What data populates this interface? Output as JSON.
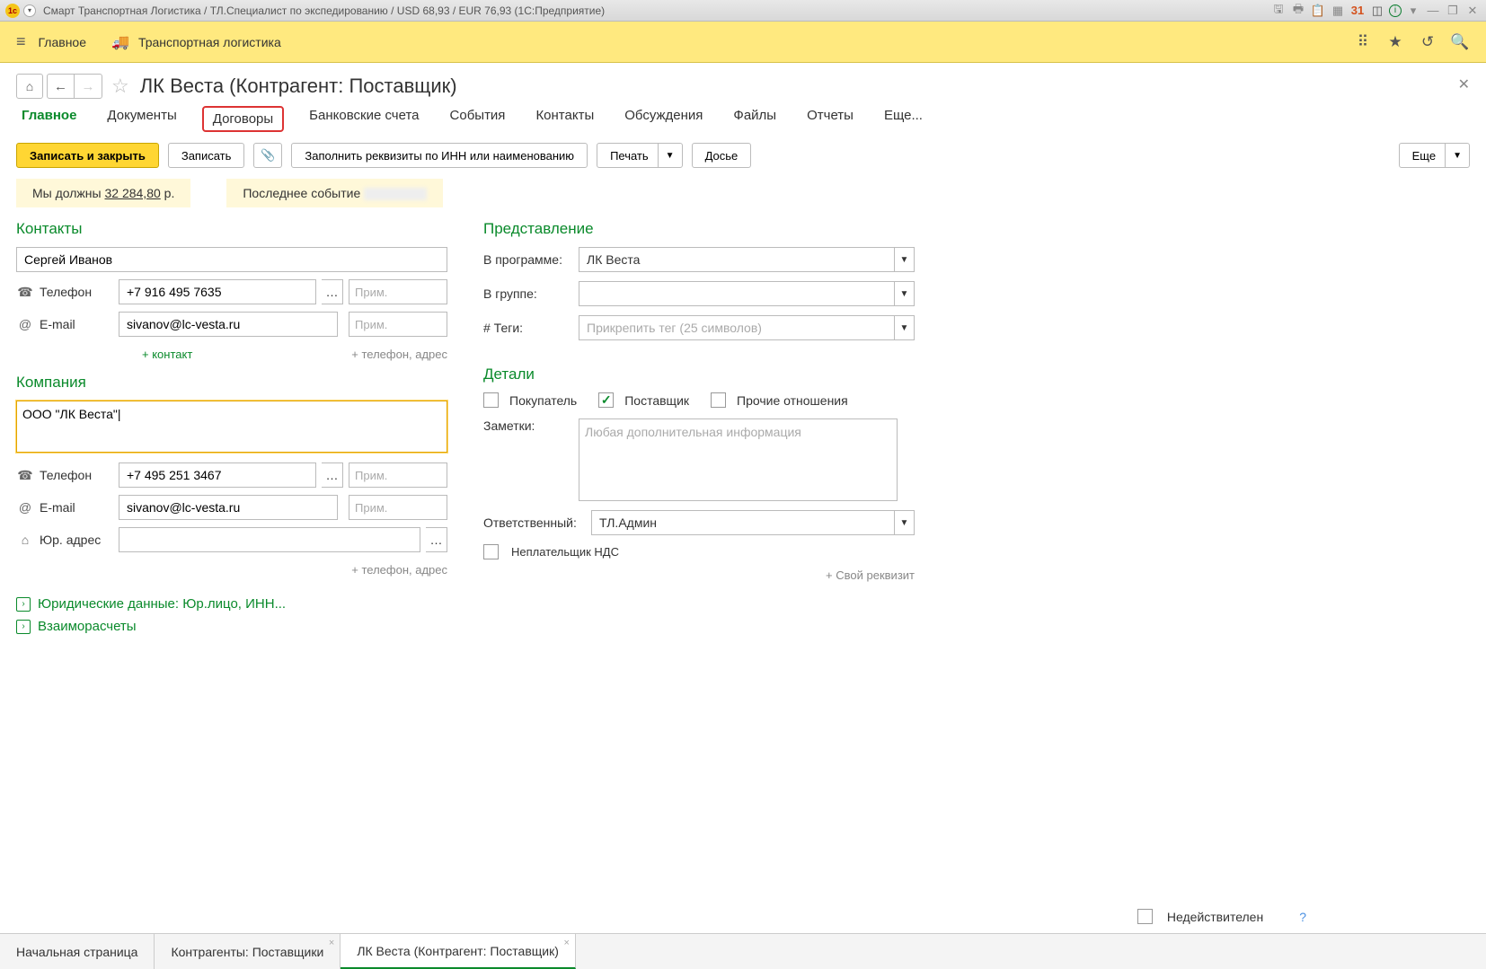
{
  "titlebar": {
    "text": "Смарт Транспортная Логистика / ТЛ.Специалист по экспедированию / USD 68,93 / EUR 76,93  (1С:Предприятие)"
  },
  "maintool": {
    "home": "Главное",
    "logistics": "Транспортная логистика"
  },
  "header": {
    "title": "ЛК Веста (Контрагент: Поставщик)"
  },
  "tabs": {
    "main": "Главное",
    "docs": "Документы",
    "contracts": "Договоры",
    "bank": "Банковские счета",
    "events": "События",
    "contacts": "Контакты",
    "discuss": "Обсуждения",
    "files": "Файлы",
    "reports": "Отчеты",
    "more": "Еще..."
  },
  "actions": {
    "save_close": "Записать и закрыть",
    "save": "Записать",
    "fill_inn": "Заполнить реквизиты по ИНН или наименованию",
    "print": "Печать",
    "dossier": "Досье",
    "more": "Еще"
  },
  "info": {
    "debt_label": "Мы должны",
    "debt_amount": "32 284,80",
    "debt_currency": "р.",
    "last_event": "Последнее событие"
  },
  "contacts": {
    "header": "Контакты",
    "name": "Сергей Иванов",
    "phone_label": "Телефон",
    "phone": "+7 916 495 7635",
    "email_label": "E-mail",
    "email": "sivanov@lc-vesta.ru",
    "note_ph": "Прим.",
    "add_contact": "+ контакт",
    "add_phone": "+ телефон, адрес"
  },
  "company": {
    "header": "Компания",
    "name": "ООО \"ЛК Веста\"",
    "phone_label": "Телефон",
    "phone": "+7 495 251 3467",
    "email_label": "E-mail",
    "email": "sivanov@lc-vesta.ru",
    "addr_label": "Юр. адрес",
    "addr": "",
    "add_phone": "+ телефон, адрес"
  },
  "represent": {
    "header": "Представление",
    "prog_label": "В программе:",
    "prog_value": "ЛК Веста",
    "group_label": "В группе:",
    "group_value": "",
    "tags_label": "# Теги:",
    "tags_ph": "Прикрепить тег (25 символов)"
  },
  "details": {
    "header": "Детали",
    "buyer": "Покупатель",
    "supplier": "Поставщик",
    "other": "Прочие отношения",
    "notes_label": "Заметки:",
    "notes_ph": "Любая дополнительная информация",
    "resp_label": "Ответственный:",
    "resp_value": "ТЛ.Админ",
    "vat": "Неплательщик НДС",
    "own_req": "+ Свой реквизит"
  },
  "expanders": {
    "legal": "Юридические данные: Юр.лицо, ИНН...",
    "mutual": "Взаиморасчеты"
  },
  "bottom": {
    "inactive": "Недействителен",
    "help": "?"
  },
  "btabs": {
    "start": "Начальная страница",
    "suppliers": "Контрагенты: Поставщики",
    "current": "ЛК Веста (Контрагент: Поставщик)"
  }
}
